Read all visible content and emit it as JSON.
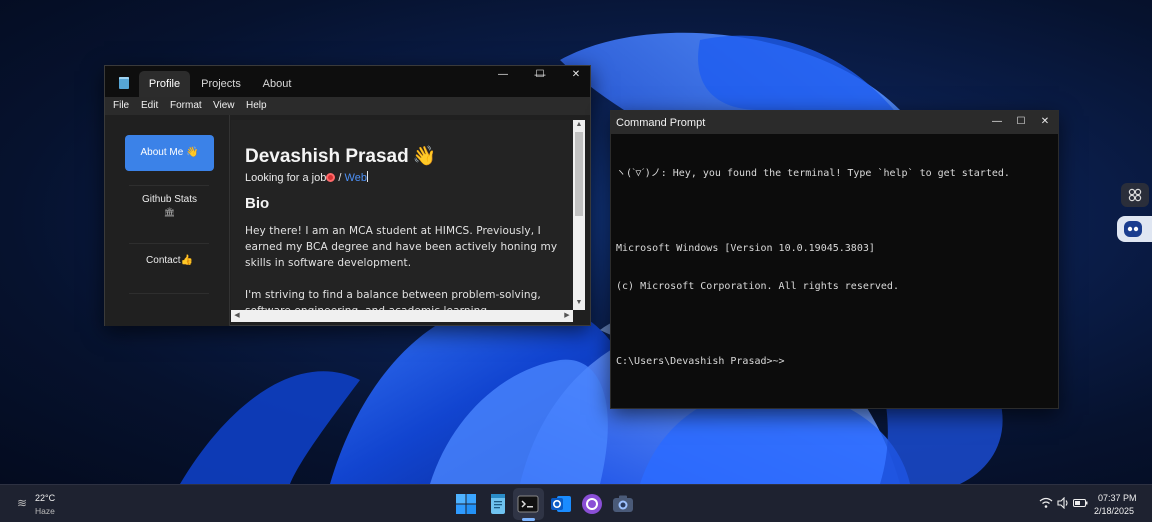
{
  "app": {
    "tabs": [
      "Profile",
      "Projects",
      "About"
    ],
    "active_tab": "Profile",
    "window_controls": {
      "minimize": "—",
      "maximize": "☐",
      "close": "✕"
    },
    "menu": [
      "File",
      "Edit",
      "Format",
      "View",
      "Help"
    ],
    "sidebar": {
      "items": [
        {
          "label": "About Me 👋",
          "active": true
        },
        {
          "label": "Github Stats",
          "sub_icon": "🏛"
        },
        {
          "label": "Contact👍"
        }
      ]
    },
    "content": {
      "name": "Devashish Prasad",
      "wave_emoji": "👋",
      "status_prefix": "Looking for a job",
      "status_sep": " / ",
      "status_field": "Web",
      "bio_heading": "Bio",
      "bio_paragraphs": [
        "Hey there! I am an MCA student at HIMCS. Previously, I earned my BCA degree and have been actively honing my skills in software development.",
        "I'm striving to find a balance between problem-solving, software engineering, and academic learning."
      ]
    },
    "colors": {
      "accent": "#3b82e8",
      "link": "#4d90f5"
    }
  },
  "terminal": {
    "title": "Command Prompt",
    "controls": {
      "minimize": "—",
      "maximize": "☐",
      "close": "✕"
    },
    "lines": [
      "ヽ(ˋ▽ˊ)ノ: Hey, you found the terminal! Type `help` to get started.",
      "",
      "Microsoft Windows [Version 10.0.19045.3803]",
      "(c) Microsoft Corporation. All rights reserved.",
      "",
      "C:\\Users\\Devashish Prasad>~>"
    ]
  },
  "taskbar": {
    "weather": {
      "temp": "22°C",
      "condition": "Haze",
      "icon": "haze-icon"
    },
    "apps": [
      "start-icon",
      "notepad-icon",
      "terminal-icon",
      "outlook-icon",
      "github-icon",
      "camera-icon"
    ],
    "tray": [
      "wifi-icon",
      "volume-icon",
      "battery-icon"
    ],
    "clock": {
      "time": "07:37 PM",
      "date": "2/18/2025"
    }
  }
}
